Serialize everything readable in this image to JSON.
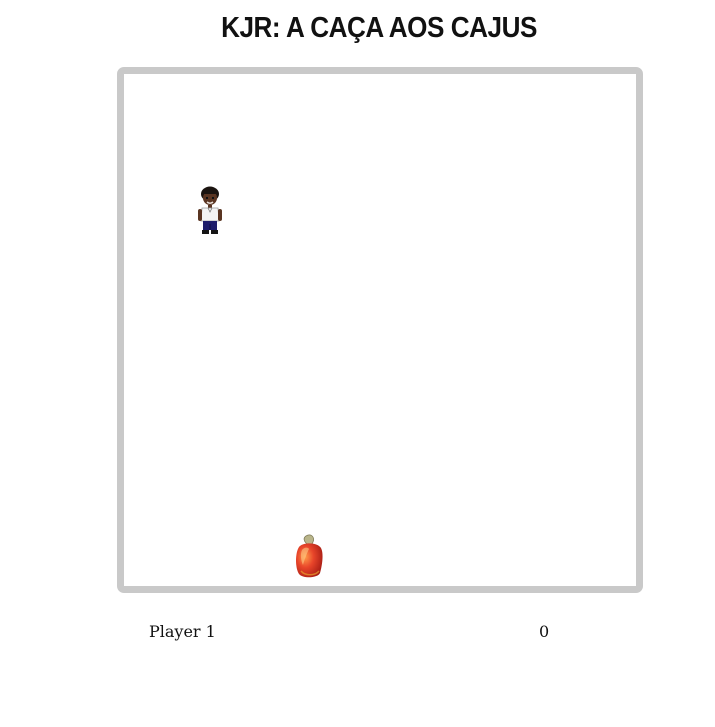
{
  "game": {
    "title": "KJR: A CAÇA AOS CAJUS"
  },
  "hud": {
    "player_name": "Player 1",
    "score": "0"
  },
  "colors": {
    "board_border": "#c9c9c9",
    "background": "#ffffff",
    "title_text": "#111111"
  },
  "sprites": {
    "player": "boy-character-sprite",
    "collectible": "cashew-fruit-sprite"
  }
}
